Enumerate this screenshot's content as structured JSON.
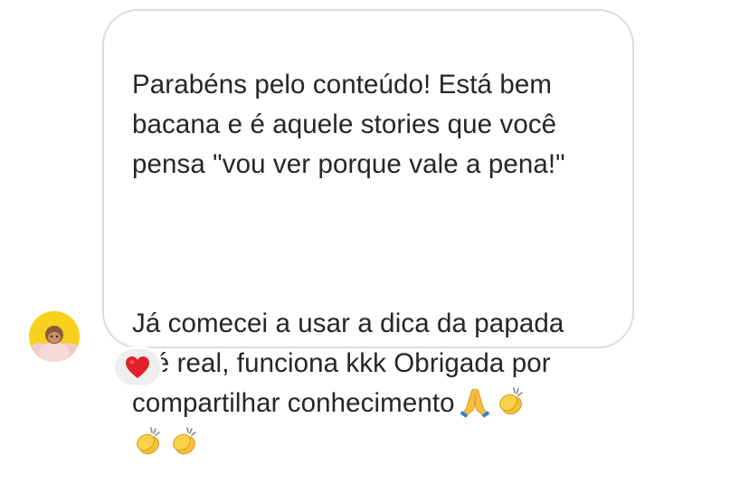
{
  "message": {
    "paragraph_1": "Parabéns pelo conteúdo! Está bem\nbacana e é aquele stories que você\npensa \"vou ver porque vale a pena!\"",
    "paragraph_2": "Já comecei a usar a dica da papada\ne é real, funciona kkk Obrigada por\ncompartilhar conhecimento",
    "emojis": [
      "folded-hands-icon",
      "clapping-hands-icon",
      "clapping-hands-icon",
      "clapping-hands-icon"
    ]
  },
  "reaction": {
    "icon": "red-heart-icon",
    "color": "#e0212b"
  },
  "avatar": {
    "background": "#f7d11b"
  }
}
